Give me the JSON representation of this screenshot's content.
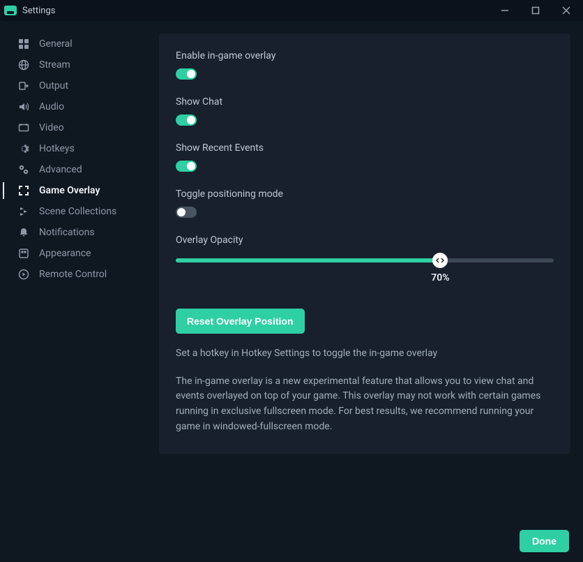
{
  "window": {
    "title": "Settings"
  },
  "sidebar": {
    "items": [
      {
        "label": "General"
      },
      {
        "label": "Stream"
      },
      {
        "label": "Output"
      },
      {
        "label": "Audio"
      },
      {
        "label": "Video"
      },
      {
        "label": "Hotkeys"
      },
      {
        "label": "Advanced"
      },
      {
        "label": "Game Overlay"
      },
      {
        "label": "Scene Collections"
      },
      {
        "label": "Notifications"
      },
      {
        "label": "Appearance"
      },
      {
        "label": "Remote Control"
      }
    ]
  },
  "panel": {
    "enable_overlay": {
      "label": "Enable in-game overlay",
      "value": true
    },
    "show_chat": {
      "label": "Show Chat",
      "value": true
    },
    "show_events": {
      "label": "Show Recent Events",
      "value": true
    },
    "positioning": {
      "label": "Toggle positioning mode",
      "value": false
    },
    "opacity": {
      "label": "Overlay Opacity",
      "value": 70,
      "display": "70%"
    },
    "reset_button": "Reset Overlay Position",
    "hint1": "Set a hotkey in Hotkey Settings to toggle the in-game overlay",
    "hint2": "The in-game overlay is a new experimental feature that allows you to view chat and events overlayed on top of your game. This overlay may not work with certain games running in exclusive fullscreen mode. For best results, we recommend running your game in windowed-fullscreen mode."
  },
  "footer": {
    "done": "Done"
  }
}
